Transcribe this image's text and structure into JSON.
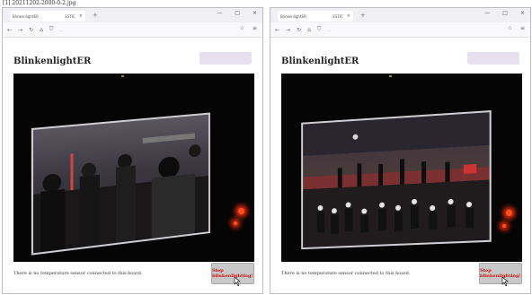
{
  "caption": "[1] 20211202-2000-0-2.jpg",
  "windows": [
    {
      "tab_title": "BlinkenlightER",
      "tab_extra": "ESTIC",
      "url": "...",
      "heading": "BlinkenlightER",
      "status_text": "There is no temperature sensor connected to this board.",
      "stop_button": "Stop blinkenlighting!",
      "footnote": "..."
    },
    {
      "tab_title": "BlinkenlightER",
      "tab_extra": "ESTIC",
      "url": "...",
      "heading": "BlinkenlightER",
      "status_text": "There is no temperature sensor connected to this board.",
      "stop_button": "Stop blinkenlighting!",
      "footnote": "..."
    }
  ],
  "icons": {
    "back": "←",
    "forward": "→",
    "reload": "↻",
    "home": "⌂",
    "shield": "⛉",
    "lock": "🔒",
    "star": "☆",
    "menu": "≡",
    "newtab": "+",
    "close": "×",
    "minimize": "—",
    "maximize": "□"
  },
  "colors": {
    "stop_text": "#d01010",
    "pill": "#e6e0f0",
    "camera_bg": "#050505"
  }
}
